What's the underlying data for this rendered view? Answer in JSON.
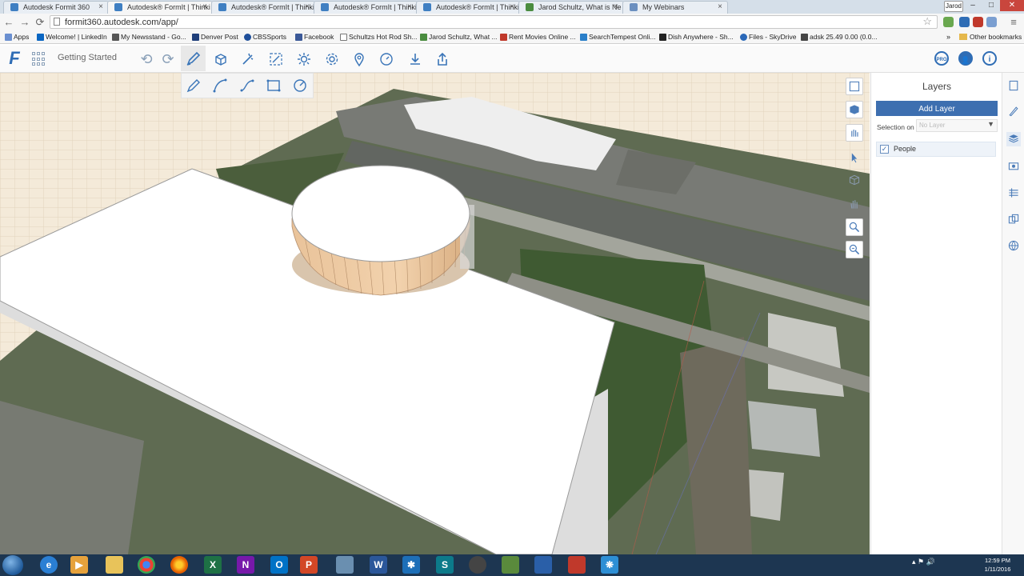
{
  "browser": {
    "tabs": [
      {
        "label": "Autodesk Formit 360",
        "color": "#3f7fc2",
        "active": false
      },
      {
        "label": "Autodesk® FormIt | Thinki",
        "color": "#3f7fc2",
        "active": true
      },
      {
        "label": "Autodesk® FormIt | Thinki",
        "color": "#3f7fc2",
        "active": false
      },
      {
        "label": "Autodesk® FormIt | Thinki",
        "color": "#3f7fc2",
        "active": false
      },
      {
        "label": "Autodesk® FormIt | Thinki",
        "color": "#3f7fc2",
        "active": false
      },
      {
        "label": "Jarod Schultz, What is Ne",
        "color": "#4a8c3f",
        "active": false
      },
      {
        "label": "My Webinars",
        "color": "#6b8fbf",
        "active": false
      }
    ],
    "tab_close": "×",
    "profile": "Jarod",
    "window": {
      "minimize": "–",
      "maximize": "□",
      "close": "✕"
    },
    "url": "formit360.autodesk.com/app/",
    "back": "←",
    "forward": "→",
    "reload": "⟳",
    "star": "☆",
    "menu": "≡",
    "bookmarks": [
      {
        "label": "Apps",
        "color": "#6a8fd0"
      },
      {
        "label": "Welcome! | LinkedIn",
        "color": "#0a66c2"
      },
      {
        "label": "My Newsstand - Go...",
        "color": "#555"
      },
      {
        "label": "Denver Post",
        "color": "#1f3f7a"
      },
      {
        "label": "CBSSports",
        "color": "#1f4f9a"
      },
      {
        "label": "Facebook",
        "color": "#3b5998"
      },
      {
        "label": "Schultzs Hot Rod Sh...",
        "color": "#777"
      },
      {
        "label": "Jarod Schultz, What ...",
        "color": "#4a8c3f"
      },
      {
        "label": "Rent Movies Online ...",
        "color": "#c0392b"
      },
      {
        "label": "SearchTempest Onli...",
        "color": "#2a7fc9"
      },
      {
        "label": "Dish Anywhere - Sh...",
        "color": "#222"
      },
      {
        "label": "Files - SkyDrive",
        "color": "#2a68b8"
      },
      {
        "label": "adsk 25.49 0.00 (0.0...",
        "color": "#444"
      }
    ],
    "bookmarks_more": "»",
    "other_bookmarks": "Other bookmarks"
  },
  "app": {
    "project_title": "Getting Started",
    "undo": "⟲",
    "redo": "⟳",
    "header_right": {
      "pro": "PRO",
      "account": "👤",
      "info": "i"
    }
  },
  "layers_panel": {
    "title": "Layers",
    "add_button": "Add Layer",
    "selection_label": "Selection on",
    "selection_value": "No Layer",
    "layers": [
      {
        "name": "People",
        "checked": true
      }
    ]
  },
  "taskbar": {
    "clock_time": "12:59 PM",
    "clock_date": "1/11/2016",
    "tray": "▴ ⚑ 🔊"
  }
}
